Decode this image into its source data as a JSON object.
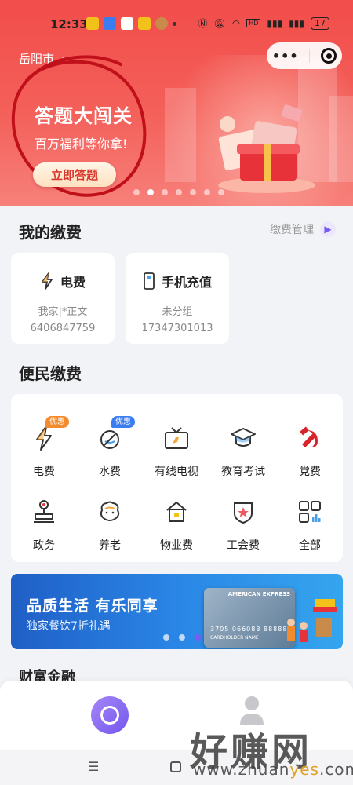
{
  "status_bar": {
    "time": "12:33",
    "battery": "17"
  },
  "header": {
    "city": "岳阳市",
    "capsule_more": "•••"
  },
  "banner": {
    "title": "答题大闯关",
    "subtitle": "百万福利等你拿!",
    "button": "立即答题",
    "active_dot": 1,
    "dot_count": 7
  },
  "my_bills": {
    "title": "我的缴费",
    "manage_label": "缴费管理",
    "cards": [
      {
        "name": "电费",
        "sub": "我家|*正文",
        "number": "6406847759",
        "icon": "lightning-icon"
      },
      {
        "name": "手机充值",
        "sub": "未分组",
        "number": "17347301013",
        "icon": "phone-icon"
      }
    ]
  },
  "services": {
    "title": "便民缴费",
    "items": [
      {
        "label": "电费",
        "icon": "lightning-icon",
        "tag": "优惠",
        "tag_color": "#f28a2e"
      },
      {
        "label": "水费",
        "icon": "water-drop-icon",
        "tag": "优惠",
        "tag_color": "#3b7cf0"
      },
      {
        "label": "有线电视",
        "icon": "tv-icon"
      },
      {
        "label": "教育考试",
        "icon": "graduation-cap-icon"
      },
      {
        "label": "党费",
        "icon": "party-emblem-icon"
      },
      {
        "label": "政务",
        "icon": "stamp-icon"
      },
      {
        "label": "养老",
        "icon": "elderly-icon"
      },
      {
        "label": "物业费",
        "icon": "house-icon"
      },
      {
        "label": "工会费",
        "icon": "union-badge-icon"
      },
      {
        "label": "全部",
        "icon": "grid-apps-icon"
      }
    ]
  },
  "promo": {
    "title": "品质生活  有乐同享",
    "subtitle": "独家餐饮7折礼遇",
    "card_brand": "AMERICAN EXPRESS",
    "card_number": "3705 066088 88888",
    "card_holder": "CARDHOLDER NAME",
    "active_dot": 2,
    "dot_count": 3
  },
  "wealth": {
    "title": "财富金融"
  },
  "nav": {
    "menu_glyph": "☰"
  },
  "watermark": {
    "text": "好赚网",
    "url_prefix": "www.zhuan",
    "url_highlight": "yes",
    "url_suffix": ".com"
  },
  "colors": {
    "brand_red": "#f24d4a",
    "accent_purple": "#7b5cf0",
    "promo_blue": "#2a86e6"
  }
}
